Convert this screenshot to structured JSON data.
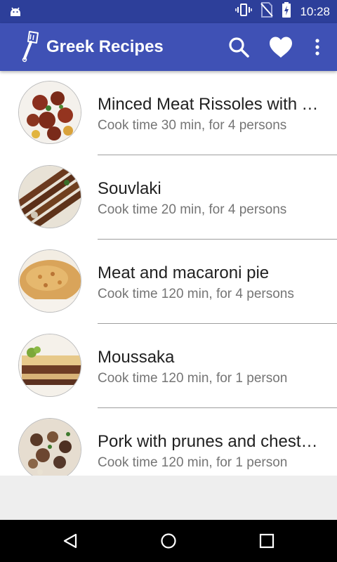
{
  "status_bar": {
    "time": "10:28",
    "icons": [
      "android-icon",
      "vibrate-icon",
      "no-sim-icon",
      "battery-charging-icon"
    ]
  },
  "app_bar": {
    "title": "Greek Recipes",
    "logo_icon": "spatula-icon",
    "actions": [
      "search-icon",
      "heart-icon",
      "overflow-menu-icon"
    ]
  },
  "recipes": [
    {
      "title": "Minced Meat Rissoles with Tomato Sauce",
      "subtitle": "Cook time 30 min, for 4 persons"
    },
    {
      "title": "Souvlaki",
      "subtitle": "Cook time 20 min, for 4 persons"
    },
    {
      "title": "Meat and macaroni pie",
      "subtitle": "Cook time 120 min, for 4 persons"
    },
    {
      "title": "Moussaka",
      "subtitle": "Cook time 120 min, for 1 person"
    },
    {
      "title": "Pork with prunes and chestnuts",
      "subtitle": "Cook time 120 min, for 1 person"
    }
  ],
  "nav_bar": {
    "buttons": [
      "back-icon",
      "home-icon",
      "recent-apps-icon"
    ]
  },
  "colors": {
    "status_bar": "#2d3f9a",
    "app_bar": "#3f51b5",
    "title_text": "#212121",
    "subtitle_text": "#757575"
  }
}
